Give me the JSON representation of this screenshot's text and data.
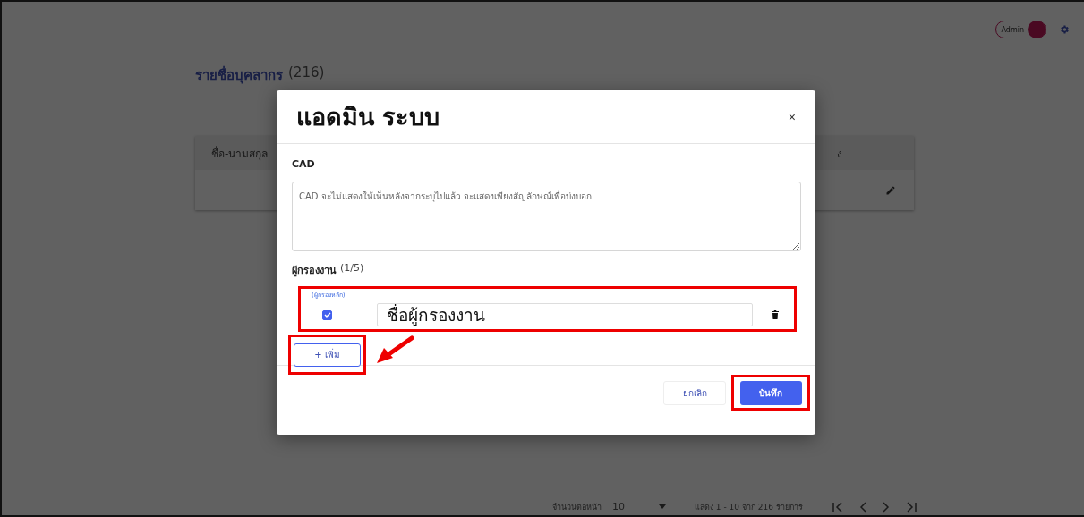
{
  "header": {
    "toggle": {
      "label": "Admin",
      "on": true
    }
  },
  "page": {
    "title": "รายชื่อบุคลากร",
    "count": "(216)"
  },
  "table": {
    "columns": [
      "ชื่อ-นามสกุล",
      "ง"
    ]
  },
  "pagination": {
    "per_page_label": "จำนวนต่อหน้า",
    "per_page": "10",
    "range": "แสดง 1 - 10 จาก 216 รายการ"
  },
  "dialog": {
    "title": "แอดมิน ระบบ",
    "close": "×",
    "cad_label": "CAD",
    "cad_placeholder": "CAD จะไม่แสดงให้เห็นหลังจากระบุไปแล้ว จะแสดงเพียงสัญลักษณ์เพื่อบ่งบอก",
    "reviewers_label": "ผู้กรองงาน",
    "reviewers_count": "(1/5)",
    "reviewers": [
      {
        "caption": "(ผู้กรองหลัก)",
        "checked": true,
        "name": "ชื่อผู้กรองงาน"
      }
    ],
    "add_button": "+ เพิ่ม",
    "cancel": "ยกเลิก",
    "save": "บันทึก"
  }
}
